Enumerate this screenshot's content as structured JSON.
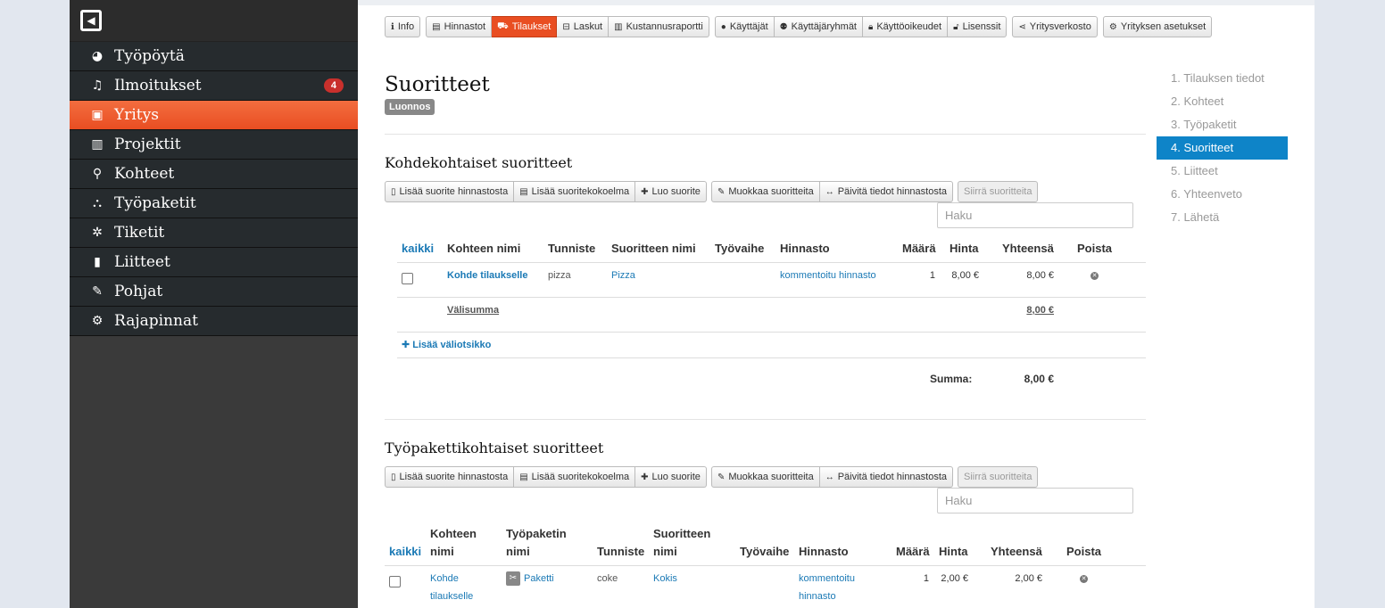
{
  "sidebar": {
    "logo_icon": "collapse-icon",
    "items": [
      {
        "label": "Työpöytä",
        "icon": "dashboard-icon",
        "glyph": "◕"
      },
      {
        "label": "Ilmoitukset",
        "icon": "bell-icon",
        "glyph": "🔔",
        "badge": "4"
      },
      {
        "label": "Yritys",
        "icon": "briefcase-icon",
        "glyph": "▣"
      },
      {
        "label": "Projektit",
        "icon": "bar-chart-icon",
        "glyph": "▥"
      },
      {
        "label": "Kohteet",
        "icon": "map-marker-icon",
        "glyph": "⚲"
      },
      {
        "label": "Työpaketit",
        "icon": "sitemap-icon",
        "glyph": "⛬"
      },
      {
        "label": "Tiketit",
        "icon": "bug-icon",
        "glyph": "✲"
      },
      {
        "label": "Liitteet",
        "icon": "file-icon",
        "glyph": "▮"
      },
      {
        "label": "Pohjat",
        "icon": "pencil-icon",
        "glyph": "✎"
      },
      {
        "label": "Rajapinnat",
        "icon": "cogs-icon",
        "glyph": "⚙"
      }
    ]
  },
  "topnav": {
    "info": "Info",
    "hinnastot": "Hinnastot",
    "tilaukset": "Tilaukset",
    "laskut": "Laskut",
    "kustannus": "Kustannusraportti",
    "kayttajat": "Käyttäjät",
    "ryhmat": "Käyttäjäryhmät",
    "oikeudet": "Käyttöoikeudet",
    "lisenssit": "Lisenssit",
    "verkosto": "Yritysverkosto",
    "asetukset": "Yrityksen asetukset"
  },
  "page": {
    "title": "Suoritteet",
    "status": "Luonnos"
  },
  "toolbar": {
    "add_from_pricelist": "Lisää suorite hinnastosta",
    "add_collection": "Lisää suoritekokoelma",
    "create": "Luo suorite",
    "edit": "Muokkaa suoritteita",
    "update": "Päivitä tiedot hinnastosta",
    "move": "Siirrä suoritteita",
    "search_placeholder": "Haku"
  },
  "section1": {
    "title": "Kohdekohtaiset suoritteet",
    "headers": {
      "all": "kaikki",
      "target": "Kohteen nimi",
      "code": "Tunniste",
      "name": "Suoritteen nimi",
      "phase": "Työvaihe",
      "pricelist": "Hinnasto",
      "qty": "Määrä",
      "price": "Hinta",
      "total": "Yhteensä",
      "delete": "Poista"
    },
    "row": {
      "target": "Kohde tilaukselle",
      "code": "pizza",
      "name": "Pizza",
      "phase": "",
      "pricelist": "kommentoitu hinnasto",
      "qty": "1",
      "price": "8,00 €",
      "total": "8,00 €"
    },
    "subtotal_label": "Välisumma",
    "subtotal_value": "8,00 €",
    "add_subheading": "Lisää väliotsikko",
    "sum_label": "Summa:",
    "sum_value": "8,00 €"
  },
  "section2": {
    "title": "Työpakettikohtaiset suoritteet",
    "headers": {
      "all": "kaikki",
      "target_1": "Kohteen",
      "target_2": "nimi",
      "package_1": "Työpaketin",
      "package_2": "nimi",
      "code": "Tunniste",
      "name_1": "Suoritteen",
      "name_2": "nimi",
      "phase": "Työvaihe",
      "pricelist": "Hinnasto",
      "qty": "Määrä",
      "price": "Hinta",
      "total": "Yhteensä",
      "delete": "Poista"
    },
    "row": {
      "target_1": "Kohde",
      "target_2": "tilaukselle",
      "package": "Paketti",
      "code": "coke",
      "name": "Kokis",
      "pricelist_1": "kommentoitu",
      "pricelist_2": "hinnasto",
      "qty": "1",
      "price": "2,00 €",
      "total": "2,00 €"
    }
  },
  "steps": [
    "1. Tilauksen tiedot",
    "2. Kohteet",
    "3. Työpaketit",
    "4. Suoritteet",
    "5. Liitteet",
    "6. Yhteenveto",
    "7. Lähetä"
  ],
  "colors": {
    "accent": "#e94e22",
    "link": "#1a79b5",
    "step_active": "#0e84c8",
    "badge": "#c9302c"
  }
}
